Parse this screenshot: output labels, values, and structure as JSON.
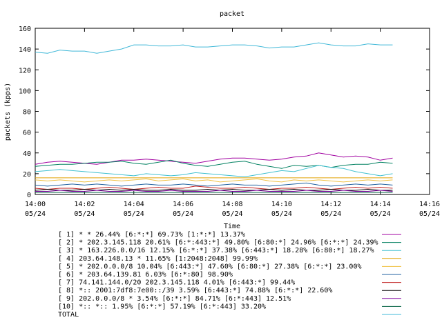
{
  "chart_data": {
    "type": "line",
    "title": "packet",
    "xlabel": "Time",
    "ylabel": "packets (kpps)",
    "ylim": [
      0,
      160
    ],
    "yticks": [
      "0",
      "20",
      "40",
      "60",
      "80",
      "100",
      "120",
      "140",
      "160"
    ],
    "xlim": [
      0,
      16
    ],
    "xticks": [
      {
        "time": "14:00",
        "date": "05/24"
      },
      {
        "time": "14:02",
        "date": "05/24"
      },
      {
        "time": "14:04",
        "date": "05/24"
      },
      {
        "time": "14:06",
        "date": "05/24"
      },
      {
        "time": "14:08",
        "date": "05/24"
      },
      {
        "time": "14:10",
        "date": "05/24"
      },
      {
        "time": "14:12",
        "date": "05/24"
      },
      {
        "time": "14:14",
        "date": "05/24"
      },
      {
        "time": "14:16",
        "date": "05/24"
      }
    ],
    "grid": false,
    "legend_position": "bottom",
    "x": [
      0,
      0.5,
      1,
      1.5,
      2,
      2.5,
      3,
      3.5,
      4,
      4.5,
      5,
      5.5,
      6,
      6.5,
      7,
      7.5,
      8,
      8.5,
      9,
      9.5,
      10,
      10.5,
      11,
      11.5,
      12,
      12.5,
      13,
      13.5,
      14,
      14.5
    ],
    "series": [
      {
        "name": "[ 1] * * 26.44%  [6:*:*] 69.73% [1:*:*] 13.37%",
        "color": "#a000a0",
        "values": [
          29,
          31,
          32,
          31,
          30,
          29,
          31,
          33,
          33,
          34,
          33,
          32,
          31,
          30,
          32,
          34,
          35,
          35,
          34,
          33,
          34,
          36,
          37,
          40,
          38,
          36,
          37,
          36,
          33,
          35
        ]
      },
      {
        "name": "[ 2] * 202.3.145.118 20.61%  [6:*:443:*] 49.80% [6:80:*] 24.96% [6:*:*] 24.39%",
        "color": "#008060",
        "values": [
          27,
          28,
          29,
          29,
          30,
          31,
          31,
          32,
          30,
          29,
          31,
          33,
          30,
          28,
          27,
          29,
          31,
          32,
          29,
          27,
          25,
          28,
          27,
          28,
          26,
          28,
          29,
          29,
          31,
          30
        ]
      },
      {
        "name": "[ 3] * 163.226.0.0/16 12.15%  [6:*:*] 37.38% [6:443:*] 18.28% [6:80:*] 18.27%",
        "color": "#40c0d0",
        "values": [
          22,
          23,
          24,
          23,
          22,
          21,
          20,
          19,
          18,
          20,
          19,
          18,
          19,
          21,
          20,
          19,
          18,
          17,
          19,
          21,
          23,
          22,
          25,
          28,
          26,
          25,
          22,
          20,
          18,
          20
        ]
      },
      {
        "name": "[ 4] 203.64.148.13 * 11.65%  [1:2048:2048] 99.99%",
        "color": "#e0a000",
        "values": [
          16,
          16,
          16,
          16,
          16,
          16,
          16,
          16,
          16,
          16,
          16,
          16,
          16,
          16,
          16,
          16,
          16,
          16,
          16,
          16,
          16,
          16,
          16,
          16,
          16,
          16,
          16,
          16,
          16,
          16
        ]
      },
      {
        "name": "[ 5] * 202.0.0.0/8 10.04%  [6:443:*] 47.60% [6:80:*] 27.38% [6:*:*] 23.00%",
        "color": "#f0c040",
        "values": [
          14,
          13,
          14,
          13,
          12,
          13,
          14,
          13,
          14,
          15,
          13,
          14,
          15,
          13,
          14,
          12,
          13,
          14,
          15,
          13,
          12,
          14,
          13,
          14,
          13,
          12,
          13,
          14,
          13,
          14
        ]
      },
      {
        "name": "[ 6] * 203.64.139.81 6.03%  [6:*:80] 98.90%",
        "color": "#2060a0",
        "values": [
          9,
          8,
          9,
          10,
          9,
          10,
          9,
          8,
          9,
          10,
          9,
          9,
          10,
          9,
          8,
          9,
          10,
          9,
          9,
          8,
          9,
          10,
          11,
          9,
          8,
          9,
          10,
          9,
          10,
          9
        ]
      },
      {
        "name": "[ 7] 74.141.144.0/20 202.3.145.118 4.01%  [6:443:*] 99.44%",
        "color": "#c02020",
        "values": [
          6,
          5,
          6,
          6,
          5,
          6,
          7,
          6,
          5,
          6,
          7,
          6,
          6,
          8,
          7,
          6,
          6,
          7,
          6,
          5,
          6,
          6,
          7,
          6,
          5,
          6,
          7,
          6,
          7,
          6
        ]
      },
      {
        "name": "[ 8] *:: 2001:7df8:7e00::/39 3.59%  [6:443:*] 74.88% [6:*:*] 22.60%",
        "color": "#000000",
        "values": [
          4,
          5,
          4,
          4,
          5,
          4,
          5,
          4,
          5,
          4,
          4,
          5,
          4,
          4,
          5,
          4,
          5,
          4,
          4,
          5,
          4,
          5,
          4,
          4,
          5,
          4,
          4,
          5,
          4,
          4
        ]
      },
      {
        "name": "[ 9] 202.0.0.0/8 * 3.54%  [6:*:*] 84.71% [6:*:443] 12.51%",
        "color": "#8000a0",
        "values": [
          3,
          3,
          4,
          3,
          3,
          4,
          3,
          3,
          4,
          3,
          3,
          4,
          3,
          3,
          3,
          4,
          3,
          3,
          4,
          3,
          3,
          3,
          4,
          3,
          3,
          4,
          3,
          3,
          4,
          3
        ]
      },
      {
        "name": "[10] *:: *:: 1.95%  [6:*:*] 57.19% [6:*:443] 33.20%",
        "color": "#006040",
        "values": [
          2,
          2,
          2,
          2,
          2,
          2,
          2,
          2,
          2,
          2,
          2,
          2,
          2,
          2,
          2,
          2,
          2,
          2,
          2,
          2,
          2,
          2,
          2,
          2,
          2,
          2,
          2,
          2,
          2,
          2
        ]
      },
      {
        "name": "TOTAL",
        "color": "#40b8d8",
        "values": [
          137,
          136,
          139,
          138,
          138,
          136,
          138,
          140,
          144,
          144,
          143,
          143,
          144,
          142,
          142,
          143,
          144,
          144,
          143,
          141,
          142,
          142,
          144,
          146,
          144,
          143,
          143,
          145,
          144,
          144
        ]
      }
    ]
  }
}
